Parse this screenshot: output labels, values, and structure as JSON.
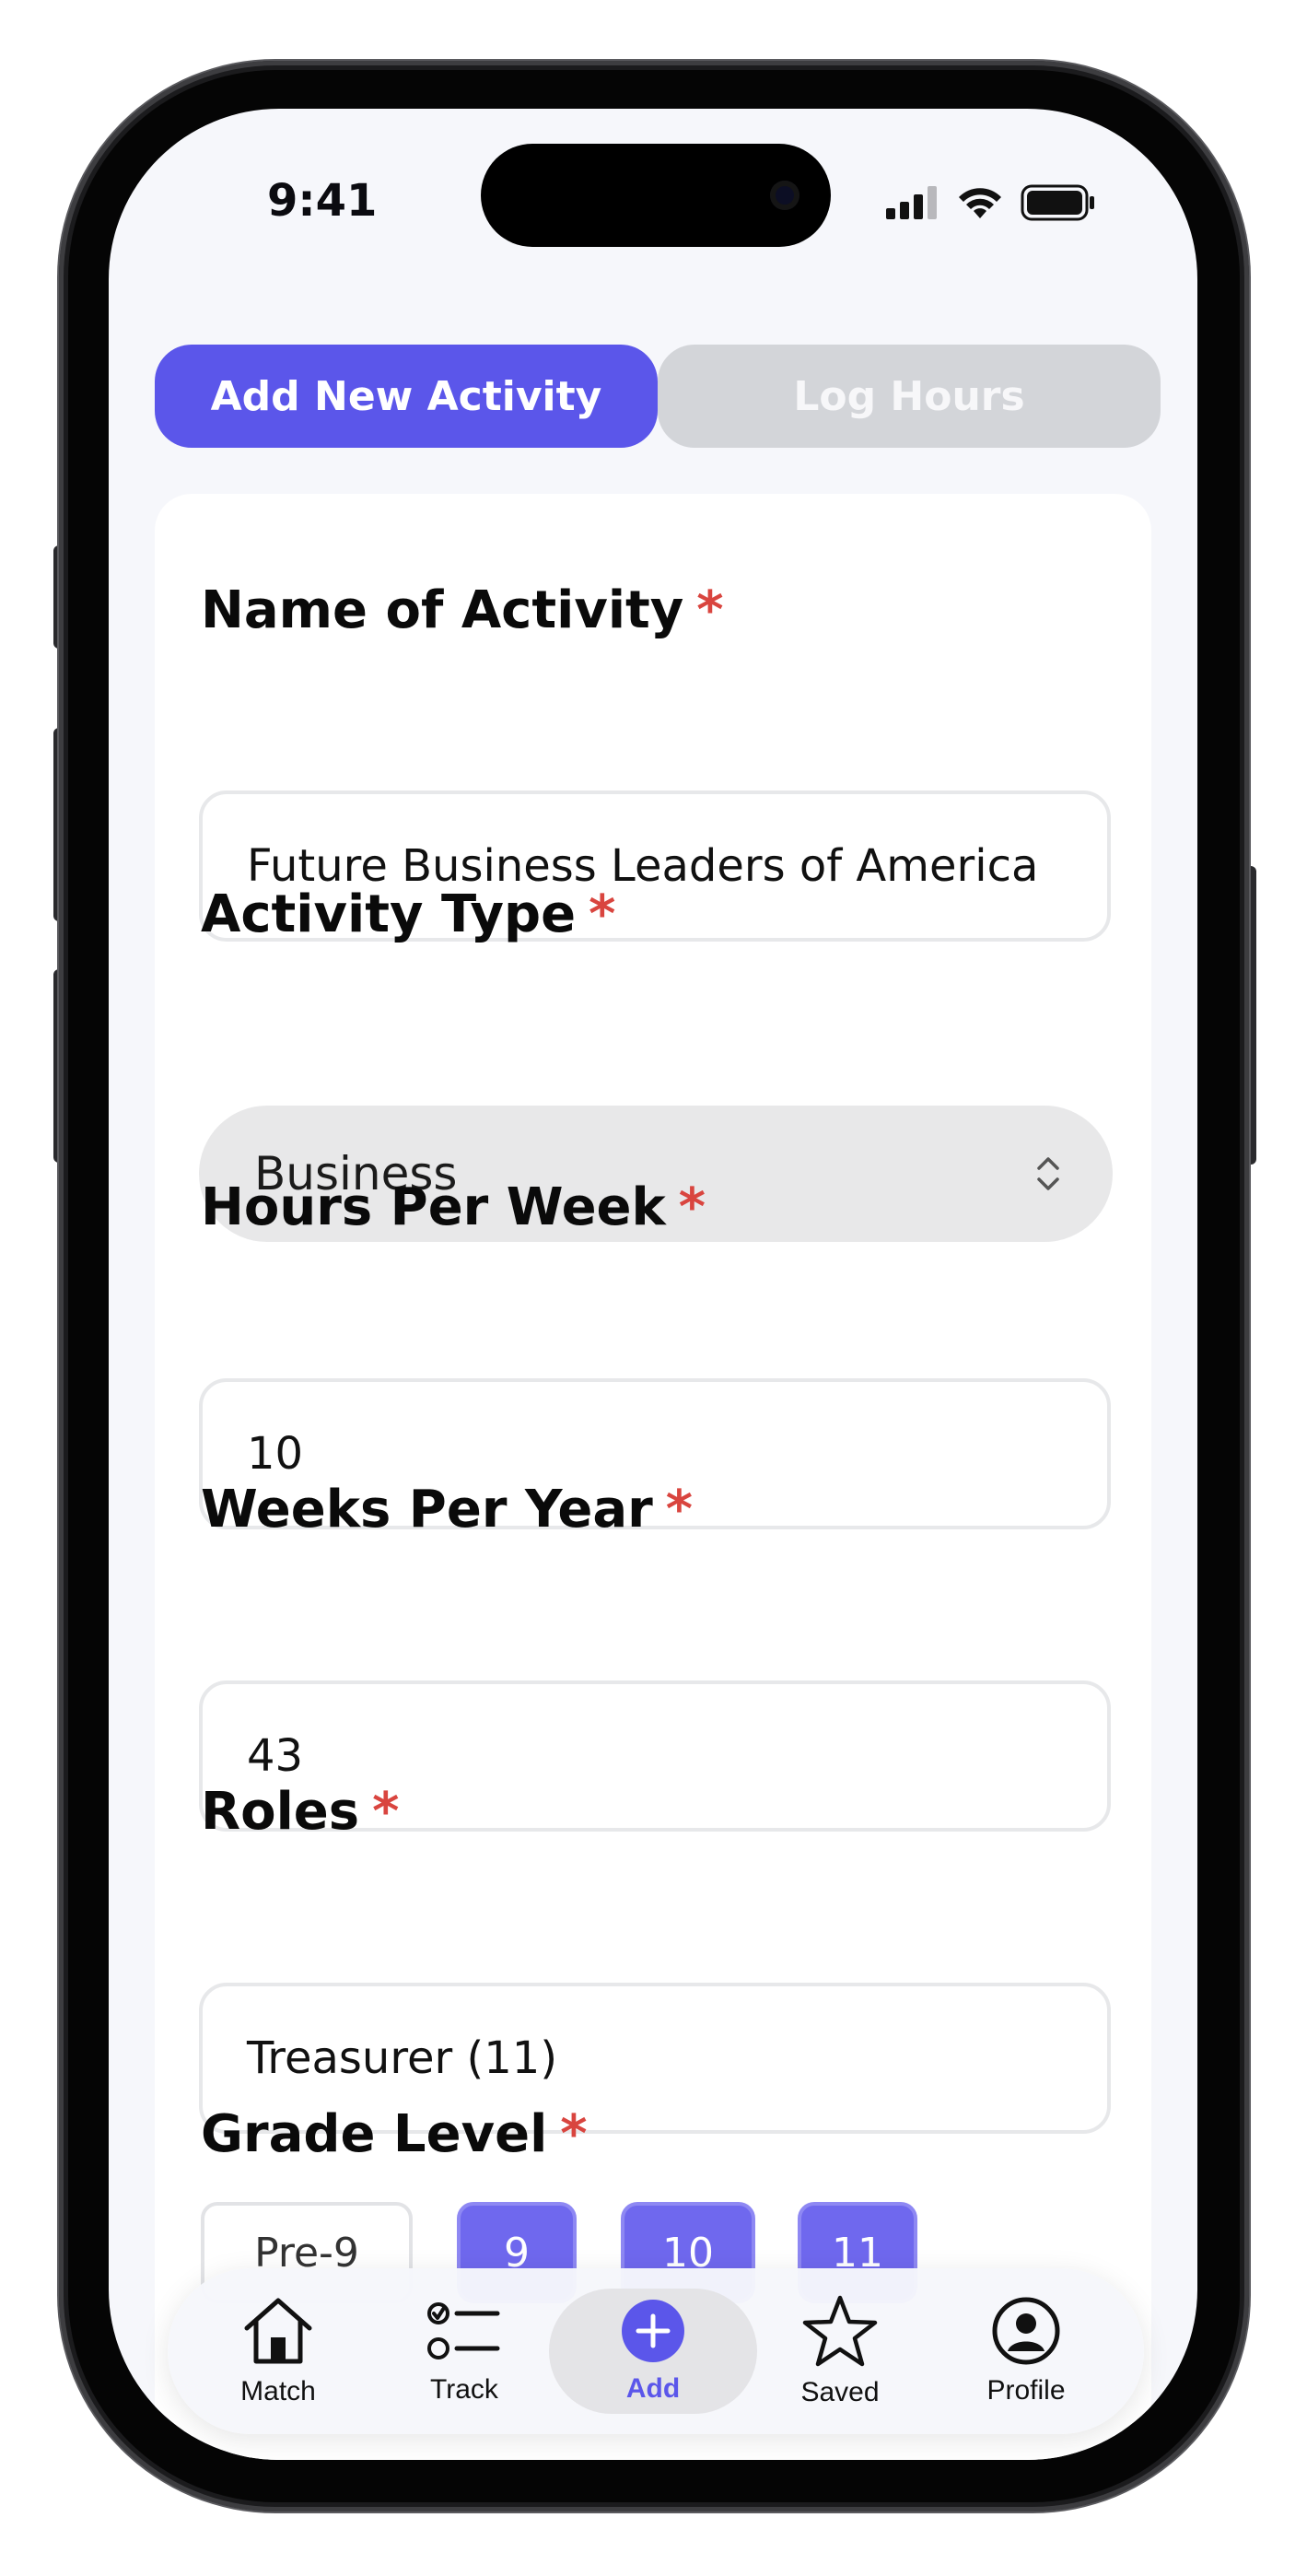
{
  "status_bar": {
    "time": "9:41"
  },
  "tabs": [
    {
      "label": "Add New Activity",
      "active": true
    },
    {
      "label": "Log Hours",
      "active": false
    }
  ],
  "form": {
    "required_mark": "*",
    "name": {
      "label": "Name of Activity",
      "value": "Future Business Leaders of America"
    },
    "type": {
      "label": "Activity Type",
      "value": "Business"
    },
    "hours": {
      "label": "Hours Per Week",
      "value": "10"
    },
    "weeks": {
      "label": "Weeks Per Year",
      "value": "43"
    },
    "roles": {
      "label": "Roles",
      "value": "Treasurer (11)"
    },
    "grade": {
      "label": "Grade Level",
      "options": [
        {
          "label": "Pre-9",
          "selected": false
        },
        {
          "label": "9",
          "selected": true
        },
        {
          "label": "10",
          "selected": true
        },
        {
          "label": "11",
          "selected": true
        }
      ]
    }
  },
  "nav": {
    "items": [
      {
        "label": "Match",
        "icon": "house-icon"
      },
      {
        "label": "Track",
        "icon": "checklist-icon"
      },
      {
        "label": "Add",
        "icon": "plus-circle-icon",
        "active": true
      },
      {
        "label": "Saved",
        "icon": "star-icon"
      },
      {
        "label": "Profile",
        "icon": "user-circle-icon"
      }
    ]
  },
  "colors": {
    "accent": "#5b56ea",
    "required": "#d9453f",
    "inactive_tab": "#d3d5d9"
  }
}
